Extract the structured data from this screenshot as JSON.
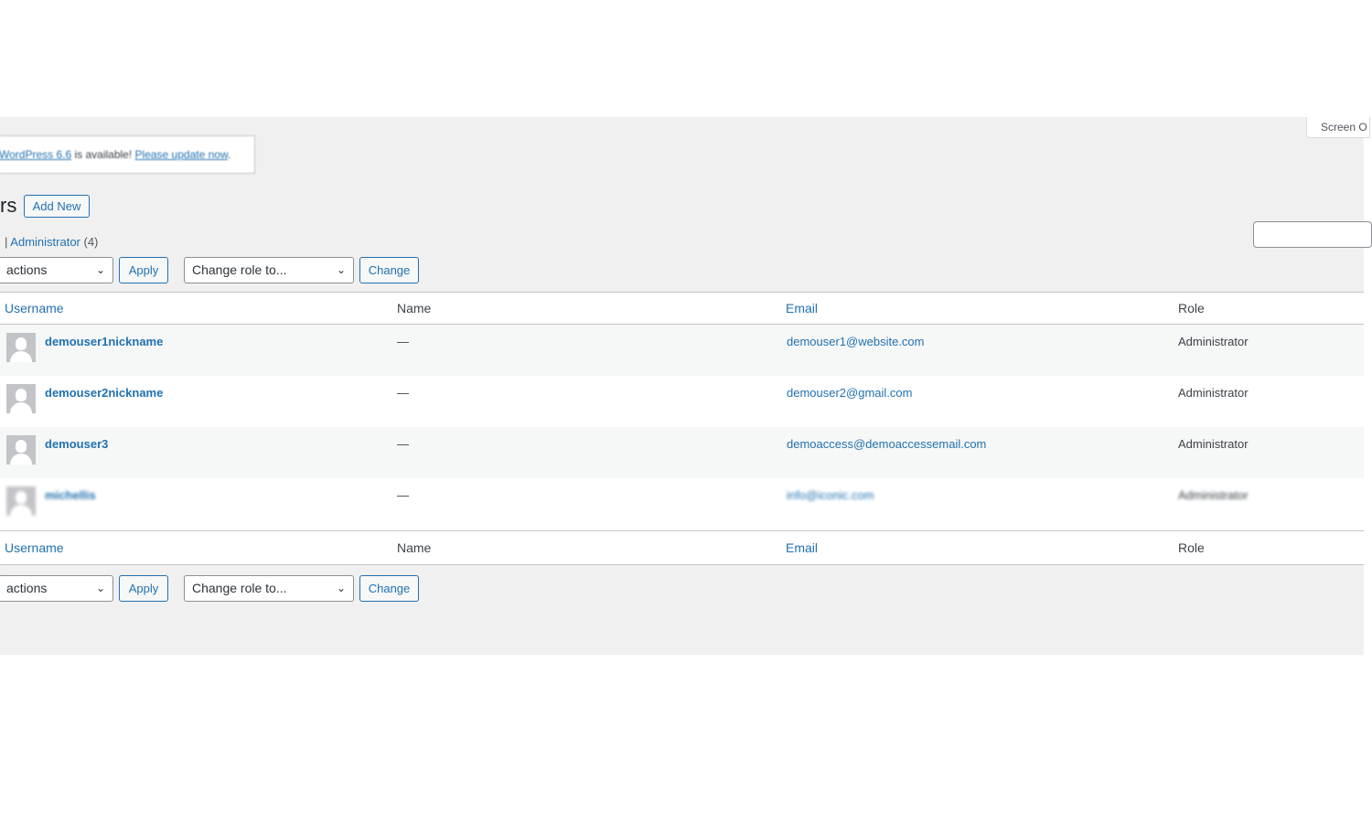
{
  "screen_options": {
    "label": "Screen O"
  },
  "notice": {
    "link1": "WordPress 6.6",
    "text": " is available! ",
    "link2": "Please update now",
    "suffix": "."
  },
  "page": {
    "title": "rs",
    "add_new_label": "Add New"
  },
  "filters": {
    "separator": "|",
    "administrator_label": "Administrator",
    "administrator_count": "(4)"
  },
  "search": {
    "value": ""
  },
  "bulk": {
    "actions_selected": "actions",
    "apply_label": "Apply",
    "role_selected": "Change role to...",
    "change_label": "Change"
  },
  "columns": {
    "username": "Username",
    "name": "Name",
    "email": "Email",
    "role": "Role"
  },
  "users": [
    {
      "username": "demouser1nickname",
      "name": "—",
      "email": "demouser1@website.com",
      "role": "Administrator"
    },
    {
      "username": "demouser2nickname",
      "name": "—",
      "email": "demouser2@gmail.com",
      "role": "Administrator"
    },
    {
      "username": "demouser3",
      "name": "—",
      "email": "demoaccess@demoaccessemail.com",
      "role": "Administrator"
    },
    {
      "username": "michellis",
      "name": "—",
      "email": "info@iconic.com",
      "role": "Administrator"
    }
  ]
}
